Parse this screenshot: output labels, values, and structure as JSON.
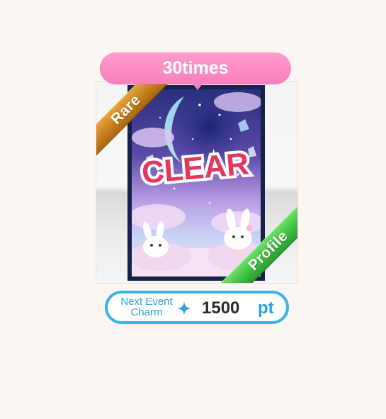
{
  "reward": {
    "times_label": "30times",
    "rarity_ribbon": "Rare",
    "type_ribbon": "Profile",
    "artwork": {
      "icon": "clear-card-artwork",
      "banner_text": "CLEAR"
    }
  },
  "charm": {
    "label_line1": "Next Event",
    "label_line2": "Charm",
    "sparkle_icon": "sparkle-icon",
    "value": "1500",
    "unit": "pt"
  },
  "colors": {
    "background": "#fcf6f2",
    "bubble_pink": "#f77fbc",
    "rare_gold": "#c57d1c",
    "profile_green": "#3fbe41",
    "charm_blue": "#3bb3ea"
  }
}
